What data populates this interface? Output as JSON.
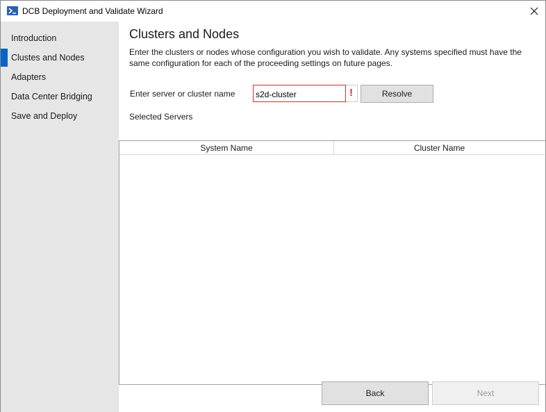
{
  "window": {
    "title": "DCB Deployment and Validate Wizard",
    "icon": "powershell-icon",
    "accent_color": "#0a64c8"
  },
  "sidebar": {
    "items": [
      {
        "label": "Introduction",
        "active": false
      },
      {
        "label": "Clustes and Nodes",
        "active": true
      },
      {
        "label": "Adapters",
        "active": false
      },
      {
        "label": "Data Center Bridging",
        "active": false
      },
      {
        "label": "Save and Deploy",
        "active": false
      }
    ]
  },
  "main": {
    "title": "Clusters and Nodes",
    "description": "Enter the clusters or nodes whose configuration you wish to validate.  Any systems specified must have the same configuration for each of the proceeding settings on future pages.",
    "server_label": "Enter server or cluster name",
    "server_value": "s2d-cluster",
    "error_indicator": "!",
    "error_color": "#e0282a",
    "resolve_label": "Resolve",
    "selected_label": "Selected Servers",
    "table": {
      "columns": [
        "System Name",
        "Cluster Name"
      ],
      "rows": []
    }
  },
  "footer": {
    "back_label": "Back",
    "next_label": "Next",
    "next_enabled": false
  }
}
